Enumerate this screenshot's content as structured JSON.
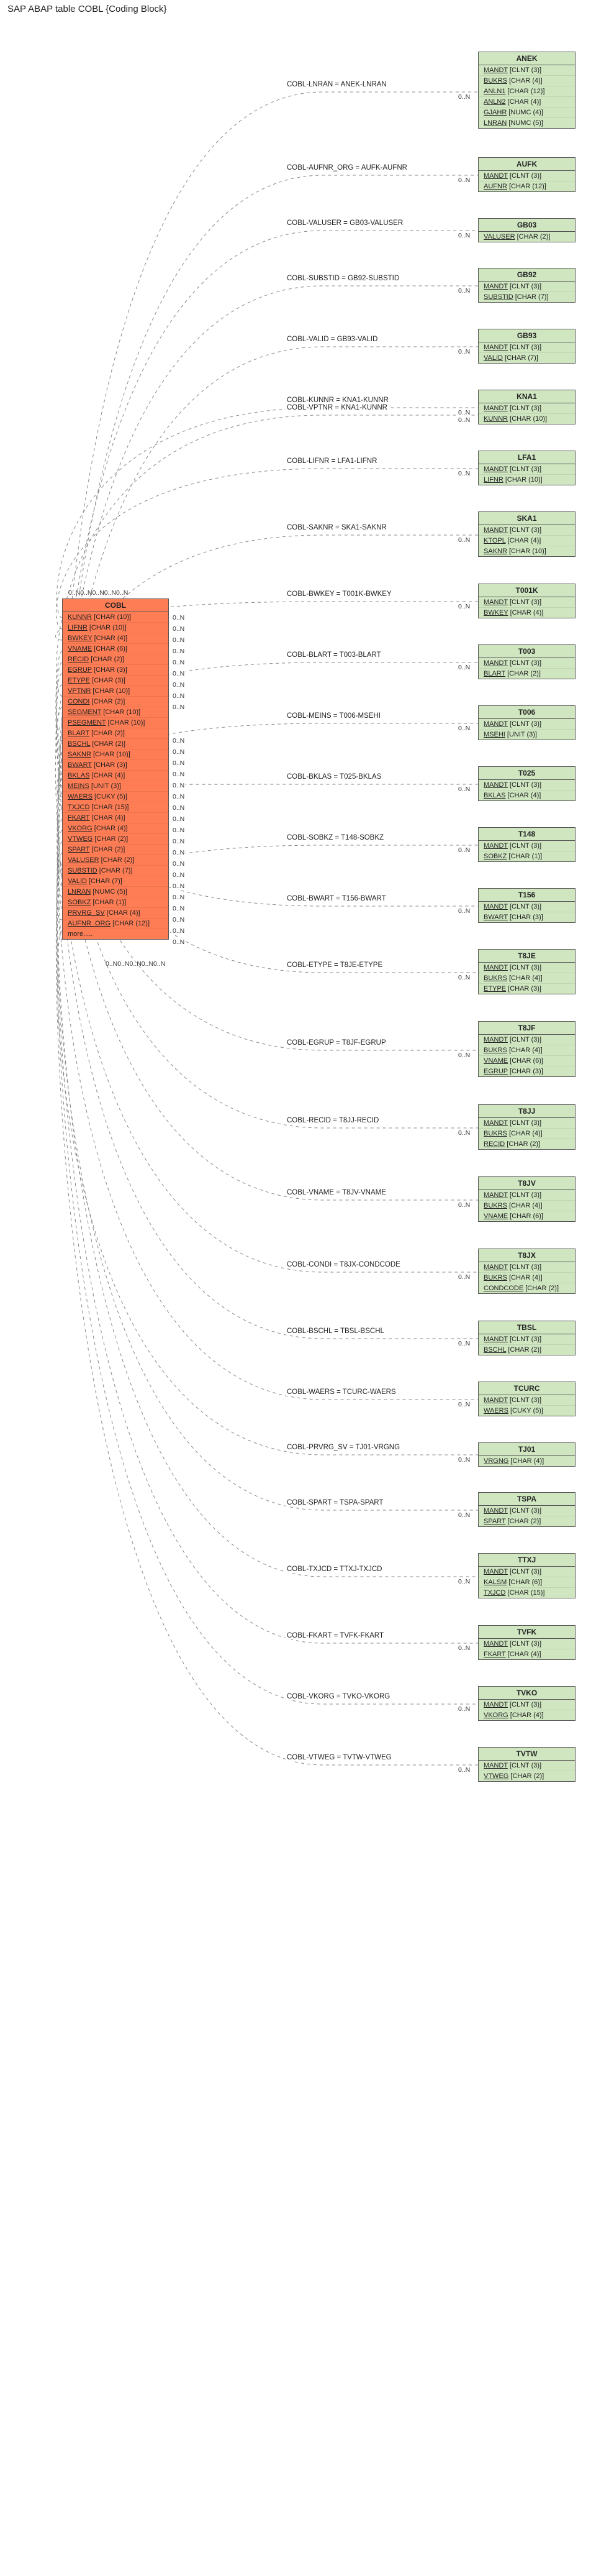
{
  "title": "SAP ABAP table COBL {Coding Block}",
  "main": {
    "name": "COBL",
    "fields": [
      "KUNNR [CHAR (10)]",
      "LIFNR [CHAR (10)]",
      "BWKEY [CHAR (4)]",
      "VNAME [CHAR (6)]",
      "RECID [CHAR (2)]",
      "EGRUP [CHAR (3)]",
      "ETYPE [CHAR (3)]",
      "VPTNR [CHAR (10)]",
      "CONDI [CHAR (2)]",
      "SEGMENT [CHAR (10)]",
      "PSEGMENT [CHAR (10)]",
      "BLART [CHAR (2)]",
      "BSCHL [CHAR (2)]",
      "SAKNR [CHAR (10)]",
      "BWART [CHAR (3)]",
      "BKLAS [CHAR (4)]",
      "MEINS [UNIT (3)]",
      "WAERS [CUKY (5)]",
      "TXJCD [CHAR (15)]",
      "FKART [CHAR (4)]",
      "VKORG [CHAR (4)]",
      "VTWEG [CHAR (2)]",
      "SPART [CHAR (2)]",
      "VALUSER [CHAR (2)]",
      "SUBSTID [CHAR (7)]",
      "VALID [CHAR (7)]",
      "LNRAN [NUMC (5)]",
      "SOBKZ [CHAR (1)]",
      "PRVRG_SV [CHAR (4)]",
      "AUFNR_ORG [CHAR (12)]",
      "more....."
    ]
  },
  "leftCardClusterTop": "0..N0..N0..N0..N0..N",
  "leftCardClusterBot": "0..N0..N0..N0..N0..N",
  "relations": [
    {
      "name": "ANEK",
      "fields": [
        "MANDT [CLNT (3)]",
        "BUKRS [CHAR (4)]",
        "ANLN1 [CHAR (12)]",
        "ANLN2 [CHAR (4)]",
        "GJAHR [NUMC (4)]",
        "LNRAN [NUMC (5)]"
      ],
      "edge": "COBL-LNRAN = ANEK-LNRAN",
      "card": "0..N"
    },
    {
      "name": "AUFK",
      "fields": [
        "MANDT [CLNT (3)]",
        "AUFNR [CHAR (12)]"
      ],
      "edge": "COBL-AUFNR_ORG = AUFK-AUFNR",
      "card": "0..N"
    },
    {
      "name": "GB03",
      "fields": [
        "VALUSER [CHAR (2)]"
      ],
      "edge": "COBL-VALUSER = GB03-VALUSER",
      "card": "0..N"
    },
    {
      "name": "GB92",
      "fields": [
        "MANDT [CLNT (3)]",
        "SUBSTID [CHAR (7)]"
      ],
      "edge": "COBL-SUBSTID = GB92-SUBSTID",
      "card": "0..N"
    },
    {
      "name": "GB93",
      "fields": [
        "MANDT [CLNT (3)]",
        "VALID [CHAR (7)]"
      ],
      "edge": "COBL-VALID = GB93-VALID",
      "card": "0..N"
    },
    {
      "name": "KNA1",
      "fields": [
        "MANDT [CLNT (3)]",
        "KUNNR [CHAR (10)]"
      ],
      "edge": "COBL-KUNNR = KNA1-KUNNR",
      "card": "0..N"
    },
    {
      "name": "KNA1",
      "fields": [],
      "edge": "COBL-VPTNR = KNA1-KUNNR",
      "card": "0..N",
      "shareBoxWithPrev": true
    },
    {
      "name": "LFA1",
      "fields": [
        "MANDT [CLNT (3)]",
        "LIFNR [CHAR (10)]"
      ],
      "edge": "COBL-LIFNR = LFA1-LIFNR",
      "card": "0..N"
    },
    {
      "name": "SKA1",
      "fields": [
        "MANDT [CLNT (3)]",
        "KTOPL [CHAR (4)]",
        "SAKNR [CHAR (10)]"
      ],
      "edge": "COBL-SAKNR = SKA1-SAKNR",
      "card": "0..N"
    },
    {
      "name": "T001K",
      "fields": [
        "MANDT [CLNT (3)]",
        "BWKEY [CHAR (4)]"
      ],
      "edge": "COBL-BWKEY = T001K-BWKEY",
      "card": "0..N"
    },
    {
      "name": "T003",
      "fields": [
        "MANDT [CLNT (3)]",
        "BLART [CHAR (2)]"
      ],
      "edge": "COBL-BLART = T003-BLART",
      "card": "0..N"
    },
    {
      "name": "T006",
      "fields": [
        "MANDT [CLNT (3)]",
        "MSEHI [UNIT (3)]"
      ],
      "edge": "COBL-MEINS = T006-MSEHI",
      "card": "0..N"
    },
    {
      "name": "T025",
      "fields": [
        "MANDT [CLNT (3)]",
        "BKLAS [CHAR (4)]"
      ],
      "edge": "COBL-BKLAS = T025-BKLAS",
      "card": "0..N"
    },
    {
      "name": "T148",
      "fields": [
        "MANDT [CLNT (3)]",
        "SOBKZ [CHAR (1)]"
      ],
      "edge": "COBL-SOBKZ = T148-SOBKZ",
      "card": "0..N"
    },
    {
      "name": "T156",
      "fields": [
        "MANDT [CLNT (3)]",
        "BWART [CHAR (3)]"
      ],
      "edge": "COBL-BWART = T156-BWART",
      "card": "0..N"
    },
    {
      "name": "T8JE",
      "fields": [
        "MANDT [CLNT (3)]",
        "BUKRS [CHAR (4)]",
        "ETYPE [CHAR (3)]"
      ],
      "edge": "COBL-ETYPE = T8JE-ETYPE",
      "card": "0..N"
    },
    {
      "name": "T8JF",
      "fields": [
        "MANDT [CLNT (3)]",
        "BUKRS [CHAR (4)]",
        "VNAME [CHAR (6)]",
        "EGRUP [CHAR (3)]"
      ],
      "edge": "COBL-EGRUP = T8JF-EGRUP",
      "card": "0..N"
    },
    {
      "name": "T8JJ",
      "fields": [
        "MANDT [CLNT (3)]",
        "BUKRS [CHAR (4)]",
        "RECID [CHAR (2)]"
      ],
      "edge": "COBL-RECID = T8JJ-RECID",
      "card": "0..N"
    },
    {
      "name": "T8JV",
      "fields": [
        "MANDT [CLNT (3)]",
        "BUKRS [CHAR (4)]",
        "VNAME [CHAR (6)]"
      ],
      "edge": "COBL-VNAME = T8JV-VNAME",
      "card": "0..N"
    },
    {
      "name": "T8JX",
      "fields": [
        "MANDT [CLNT (3)]",
        "BUKRS [CHAR (4)]",
        "CONDCODE [CHAR (2)]"
      ],
      "edge": "COBL-CONDI = T8JX-CONDCODE",
      "card": "0..N"
    },
    {
      "name": "TBSL",
      "fields": [
        "MANDT [CLNT (3)]",
        "BSCHL [CHAR (2)]"
      ],
      "edge": "COBL-BSCHL = TBSL-BSCHL",
      "card": "0..N"
    },
    {
      "name": "TCURC",
      "fields": [
        "MANDT [CLNT (3)]",
        "WAERS [CUKY (5)]"
      ],
      "edge": "COBL-WAERS = TCURC-WAERS",
      "card": "0..N"
    },
    {
      "name": "TJ01",
      "fields": [
        "VRGNG [CHAR (4)]"
      ],
      "edge": "COBL-PRVRG_SV = TJ01-VRGNG",
      "card": "0..N"
    },
    {
      "name": "TSPA",
      "fields": [
        "MANDT [CLNT (3)]",
        "SPART [CHAR (2)]"
      ],
      "edge": "COBL-SPART = TSPA-SPART",
      "card": "0..N"
    },
    {
      "name": "TTXJ",
      "fields": [
        "MANDT [CLNT (3)]",
        "KALSM [CHAR (6)]",
        "TXJCD [CHAR (15)]"
      ],
      "edge": "COBL-TXJCD = TTXJ-TXJCD",
      "card": "0..N"
    },
    {
      "name": "TVFK",
      "fields": [
        "MANDT [CLNT (3)]",
        "FKART [CHAR (4)]"
      ],
      "edge": "COBL-FKART = TVFK-FKART",
      "card": "0..N"
    },
    {
      "name": "TVKO",
      "fields": [
        "MANDT [CLNT (3)]",
        "VKORG [CHAR (4)]"
      ],
      "edge": "COBL-VKORG = TVKO-VKORG",
      "card": "0..N"
    },
    {
      "name": "TVTW",
      "fields": [
        "MANDT [CLNT (3)]",
        "VTWEG [CHAR (2)]"
      ],
      "edge": "COBL-VTWEG = TVTW-VTWEG",
      "card": "0..N"
    }
  ],
  "commonLeftCard": "0..N"
}
